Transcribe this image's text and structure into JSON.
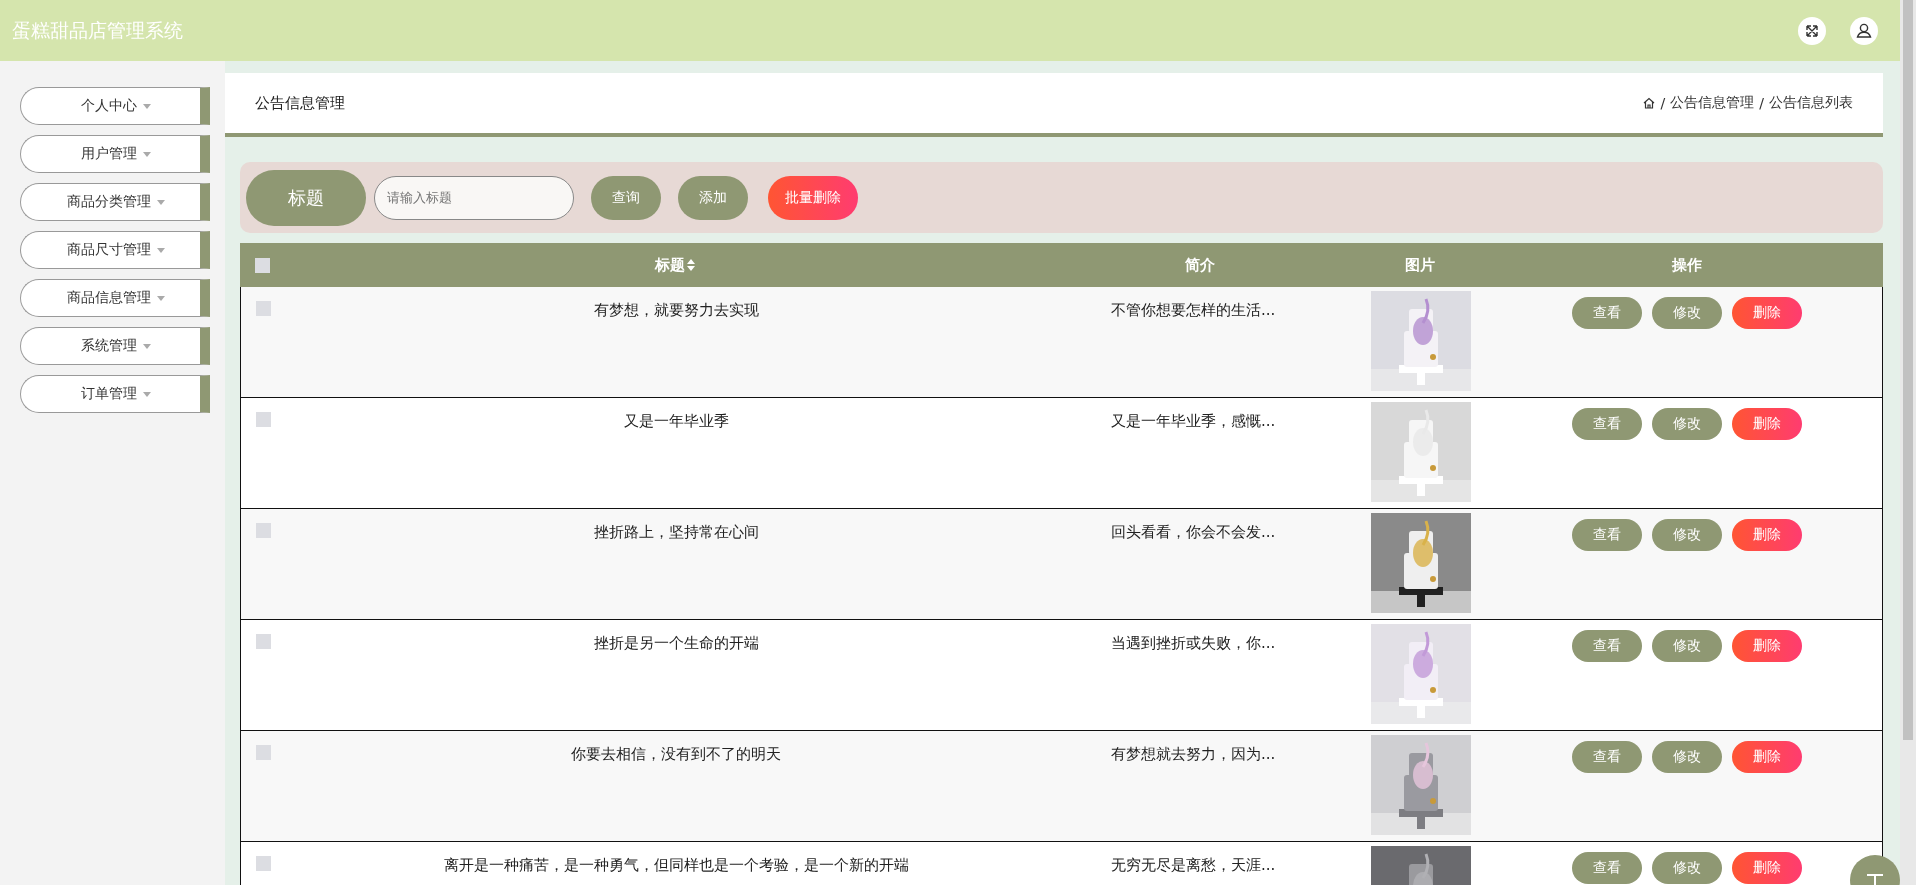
{
  "app": {
    "title": "蛋糕甜品店管理系统"
  },
  "sidebar": {
    "items": [
      {
        "label": "个人中心"
      },
      {
        "label": "用户管理"
      },
      {
        "label": "商品分类管理"
      },
      {
        "label": "商品尺寸管理"
      },
      {
        "label": "商品信息管理"
      },
      {
        "label": "系统管理"
      },
      {
        "label": "订单管理"
      }
    ]
  },
  "page": {
    "title": "公告信息管理",
    "breadcrumb": [
      "公告信息管理",
      "公告信息列表"
    ],
    "breadcrumb_separator": "/"
  },
  "search": {
    "label": "标题",
    "placeholder": "请输入标题",
    "buttons": [
      {
        "label": "查询",
        "kind": "normal"
      },
      {
        "label": "添加",
        "kind": "normal"
      },
      {
        "label": "批量删除",
        "kind": "danger"
      }
    ]
  },
  "table": {
    "select_all": {
      "checked": false
    },
    "columns": [
      "标题",
      "简介",
      "图片",
      "操作"
    ],
    "rows": [
      {
        "checked": false,
        "title": "有梦想，就要努力去实现",
        "intro": "不管你想要怎样的生活...",
        "actions": [
          "查看",
          "修改",
          "删除"
        ]
      },
      {
        "checked": false,
        "title": "又是一年毕业季",
        "intro": "又是一年毕业季，感慨...",
        "actions": [
          "查看",
          "修改",
          "删除"
        ]
      },
      {
        "checked": false,
        "title": "挫折路上，坚持常在心间",
        "intro": "回头看看，你会不会发...",
        "actions": [
          "查看",
          "修改",
          "删除"
        ]
      },
      {
        "checked": false,
        "title": "挫折是另一个生命的开端",
        "intro": "当遇到挫折或失败，你...",
        "actions": [
          "查看",
          "修改",
          "删除"
        ]
      },
      {
        "checked": false,
        "title": "你要去相信，没有到不了的明天",
        "intro": "有梦想就去努力，因为...",
        "actions": [
          "查看",
          "修改",
          "删除"
        ]
      },
      {
        "checked": false,
        "title": "离开是一种痛苦，是一种勇气，但同样也是一个考验，是一个新的开端",
        "intro": "无穷无尽是离愁，天涯...",
        "actions": [
          "查看",
          "修改",
          "删除"
        ]
      }
    ]
  }
}
